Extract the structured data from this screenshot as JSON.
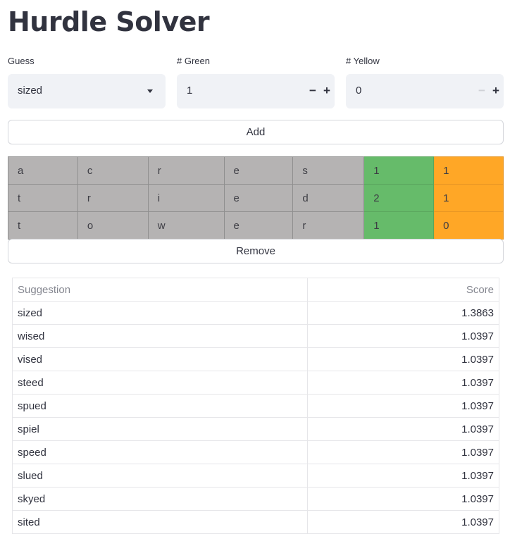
{
  "page": {
    "title": "Hurdle Solver"
  },
  "inputs": {
    "guess": {
      "label": "Guess",
      "value": "sized"
    },
    "green": {
      "label": "# Green",
      "value": "1",
      "minus": "−",
      "plus": "+"
    },
    "yellow": {
      "label": "# Yellow",
      "value": "0",
      "minus": "−",
      "plus": "+"
    }
  },
  "buttons": {
    "add": "Add",
    "remove": "Remove"
  },
  "guesses": [
    {
      "letters": [
        "a",
        "c",
        "r",
        "e",
        "s"
      ],
      "green": "1",
      "yellow": "1"
    },
    {
      "letters": [
        "t",
        "r",
        "i",
        "e",
        "d"
      ],
      "green": "2",
      "yellow": "1"
    },
    {
      "letters": [
        "t",
        "o",
        "w",
        "e",
        "r"
      ],
      "green": "1",
      "yellow": "0"
    }
  ],
  "colors": {
    "gray": "#b5b3b3",
    "green": "#66bb6a",
    "orange": "#ffa726"
  },
  "suggestions": {
    "headers": [
      "Suggestion",
      "Score"
    ],
    "rows": [
      [
        "sized",
        "1.3863"
      ],
      [
        "wised",
        "1.0397"
      ],
      [
        "vised",
        "1.0397"
      ],
      [
        "steed",
        "1.0397"
      ],
      [
        "spued",
        "1.0397"
      ],
      [
        "spiel",
        "1.0397"
      ],
      [
        "speed",
        "1.0397"
      ],
      [
        "slued",
        "1.0397"
      ],
      [
        "skyed",
        "1.0397"
      ],
      [
        "sited",
        "1.0397"
      ]
    ]
  }
}
